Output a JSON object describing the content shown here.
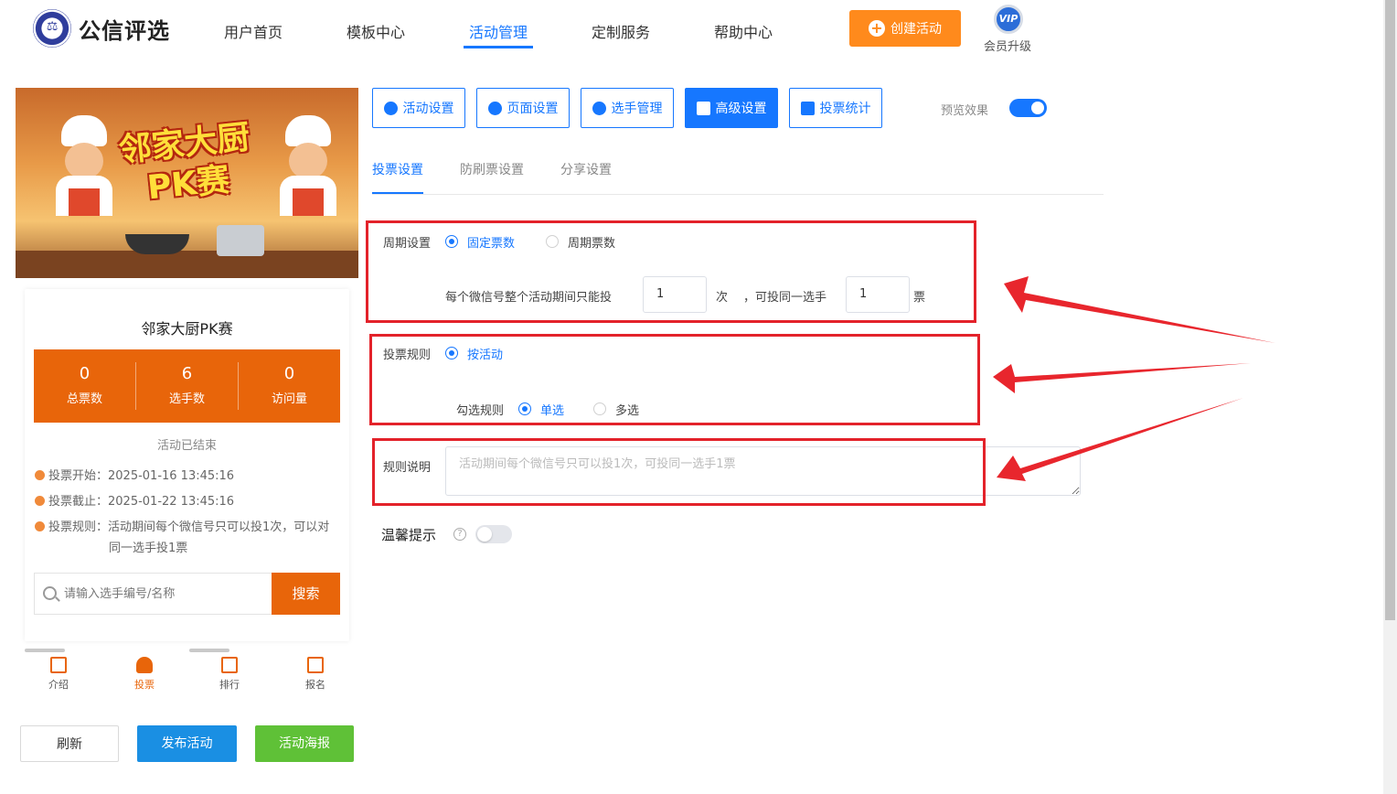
{
  "brand": {
    "name": "公信评选"
  },
  "nav": {
    "items": [
      "用户首页",
      "模板中心",
      "活动管理",
      "定制服务",
      "帮助中心"
    ],
    "active": "活动管理",
    "create_label": "创建活动",
    "vip_badge": "VIP",
    "vip_label": "会员升级"
  },
  "preview": {
    "banner_title": "邻家大厨\nPK赛",
    "activity_title": "邻家大厨PK赛",
    "stats": [
      {
        "value": "0",
        "label": "总票数"
      },
      {
        "value": "6",
        "label": "选手数"
      },
      {
        "value": "0",
        "label": "访问量"
      }
    ],
    "status": "活动已结束",
    "vote_start": "投票开始：2025-01-16 13:45:16",
    "vote_end": "投票截止：2025-01-22 13:45:16",
    "vote_rule_1": "投票规则：活动期间每个微信号只可以投1次，可以对",
    "vote_rule_2": "同一选手投1票",
    "search_placeholder": "请输入选手编号/名称",
    "search_button": "搜索",
    "tabs": [
      {
        "label": "介绍",
        "icon": "intro-icon"
      },
      {
        "label": "投票",
        "icon": "user-icon"
      },
      {
        "label": "排行",
        "icon": "rank-icon"
      },
      {
        "label": "报名",
        "icon": "signup-icon"
      }
    ],
    "active_tab": "投票"
  },
  "actions": {
    "refresh": "刷新",
    "publish": "发布活动",
    "poster": "活动海报"
  },
  "settings": {
    "buttons": [
      "活动设置",
      "页面设置",
      "选手管理",
      "高级设置",
      "投票统计"
    ],
    "active_button": "高级设置",
    "preview_label": "预览效果",
    "preview_on": true,
    "sub_tabs": [
      "投票设置",
      "防刷票设置",
      "分享设置"
    ],
    "active_sub_tab": "投票设置"
  },
  "form": {
    "cycle_label": "周期设置",
    "cycle_options": [
      "固定票数",
      "周期票数"
    ],
    "cycle_selected": "固定票数",
    "limit_prefix": "每个微信号整个活动期间只能投",
    "limit_times": "1",
    "limit_times_unit": "次",
    "limit_mid": "，可投同一选手",
    "limit_votes": "1",
    "limit_votes_unit": "票",
    "rule_label": "投票规则",
    "rule_option": "按活动",
    "select_label": "勾选规则",
    "select_options": [
      "单选",
      "多选"
    ],
    "select_selected": "单选",
    "desc_label": "规则说明",
    "desc_placeholder": "活动期间每个微信号只可以投1次，可投同一选手1票",
    "tip_label": "温馨提示",
    "tip_on": false
  },
  "colors": {
    "accent": "#1677ff",
    "orange": "#e8650a",
    "highlight": "#e3222a",
    "create": "#ff8a1c",
    "publish": "#1a8fe3",
    "poster": "#5fc137"
  }
}
